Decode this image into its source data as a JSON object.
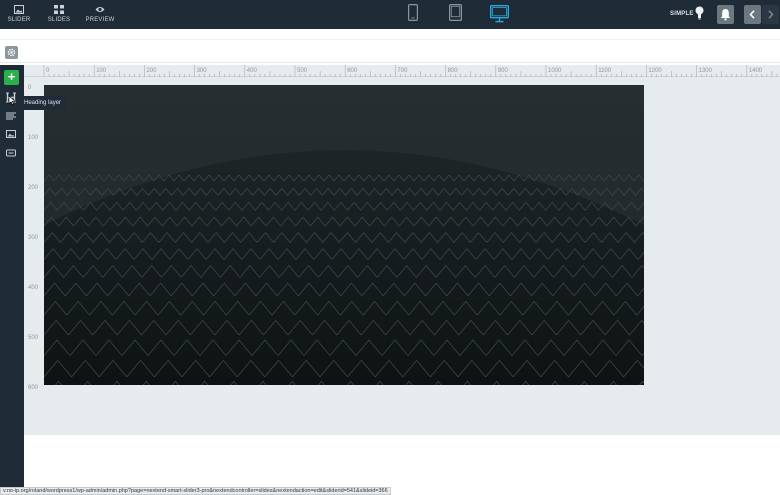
{
  "topbar": {
    "tools": [
      {
        "label": "SLIDER",
        "icon": "image-icon"
      },
      {
        "label": "SLIDES",
        "icon": "grid-icon"
      },
      {
        "label": "PREVIEW",
        "icon": "eye-icon"
      }
    ],
    "devices": [
      "mobile-icon",
      "tablet-icon",
      "desktop-icon"
    ],
    "active_device": "desktop",
    "mode_label": "SIMPLE",
    "accent_color": "#2aa8e0"
  },
  "sidebar": {
    "add_label": "+",
    "tooltip": "Heading layer",
    "icons": [
      "heading-icon",
      "text-icon",
      "image-icon",
      "button-icon"
    ]
  },
  "ruler": {
    "horizontal": [
      "0",
      "100",
      "200",
      "300",
      "400",
      "500",
      "600",
      "700",
      "800",
      "900",
      "1000",
      "1100",
      "1200",
      "1300",
      "1400"
    ],
    "vertical": [
      "0",
      "100",
      "200",
      "300",
      "400",
      "500",
      "600"
    ]
  },
  "statusbar": {
    "url": "v.no-ip.org/roland/wordpress1/wp-admin/admin.php?page=nextend-smart-slider3-pro&nextendcontroller=slides&nextendaction=edit&sliderid=541&slideid=366"
  }
}
